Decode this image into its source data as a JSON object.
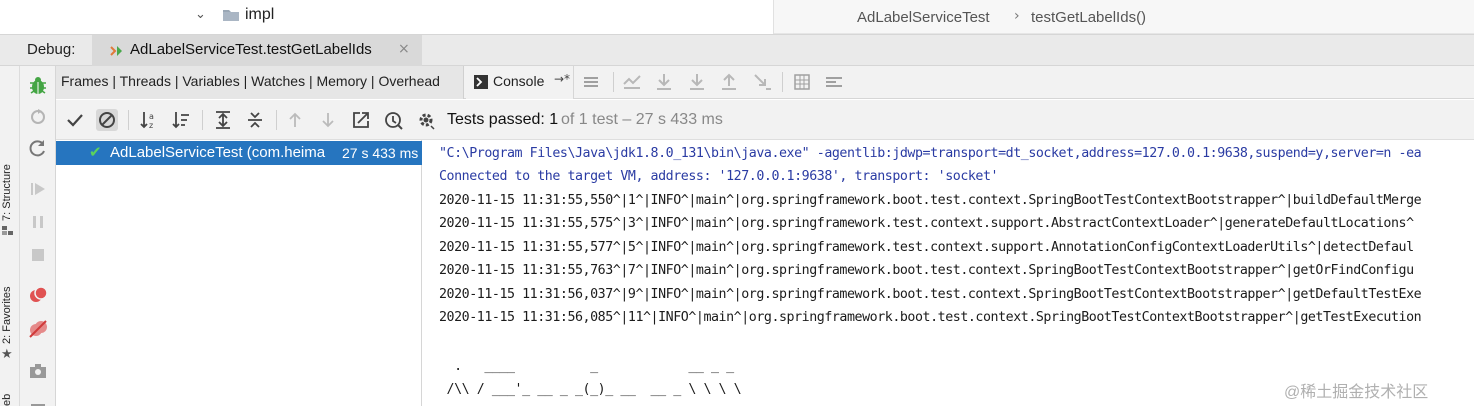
{
  "project_tree": {
    "folder": "impl"
  },
  "breadcrumb": {
    "class": "AdLabelServiceTest",
    "separator": "›",
    "method": "testGetLabelIds()"
  },
  "debug": {
    "label": "Debug:",
    "session_tab": "AdLabelServiceTest.testGetLabelIds",
    "close": "×"
  },
  "left_strip": {
    "structure": "7: Structure",
    "favorites": "2: Favorites",
    "web": "eb"
  },
  "tabs": {
    "frames_group": "Frames | Threads | Variables | Watches | Memory | Overhead",
    "console": "Console",
    "console_pin": "→*"
  },
  "status": {
    "prefix": "Tests passed:",
    "count": "1",
    "rest": "of 1 test – 27 s 433 ms"
  },
  "test_tree": {
    "name": "AdLabelServiceTest (com.heima",
    "time": "27 s 433 ms"
  },
  "console": {
    "lines": [
      "\"C:\\Program Files\\Java\\jdk1.8.0_131\\bin\\java.exe\" -agentlib:jdwp=transport=dt_socket,address=127.0.0.1:9638,suspend=y,server=n -ea",
      "Connected to the target VM, address: '127.0.0.1:9638', transport: 'socket'",
      "2020-11-15 11:31:55,550^|1^|INFO^|main^|org.springframework.boot.test.context.SpringBootTestContextBootstrapper^|buildDefaultMerge",
      "2020-11-15 11:31:55,575^|3^|INFO^|main^|org.springframework.test.context.support.AbstractContextLoader^|generateDefaultLocations^",
      "2020-11-15 11:31:55,577^|5^|INFO^|main^|org.springframework.test.context.support.AnnotationConfigContextLoaderUtils^|detectDefaul",
      "2020-11-15 11:31:55,763^|7^|INFO^|main^|org.springframework.boot.test.context.SpringBootTestContextBootstrapper^|getOrFindConfigu",
      "2020-11-15 11:31:56,037^|9^|INFO^|main^|org.springframework.boot.test.context.SpringBootTestContextBootstrapper^|getDefaultTestExe",
      "2020-11-15 11:31:56,085^|11^|INFO^|main^|org.springframework.boot.test.context.SpringBootTestContextBootstrapper^|getTestExecution"
    ],
    "ascii_lines": [
      "  .   ____          _            __ _ _",
      " /\\\\ / ___'_ __ _ _(_)_ __  __ _ \\ \\ \\ \\"
    ]
  },
  "watermark": "@稀土掘金技术社区",
  "colors": {
    "selection": "#2675bf",
    "pass_green": "#5cd35c",
    "command_blue": "#2a3ba3",
    "bug_green": "#44a544"
  }
}
